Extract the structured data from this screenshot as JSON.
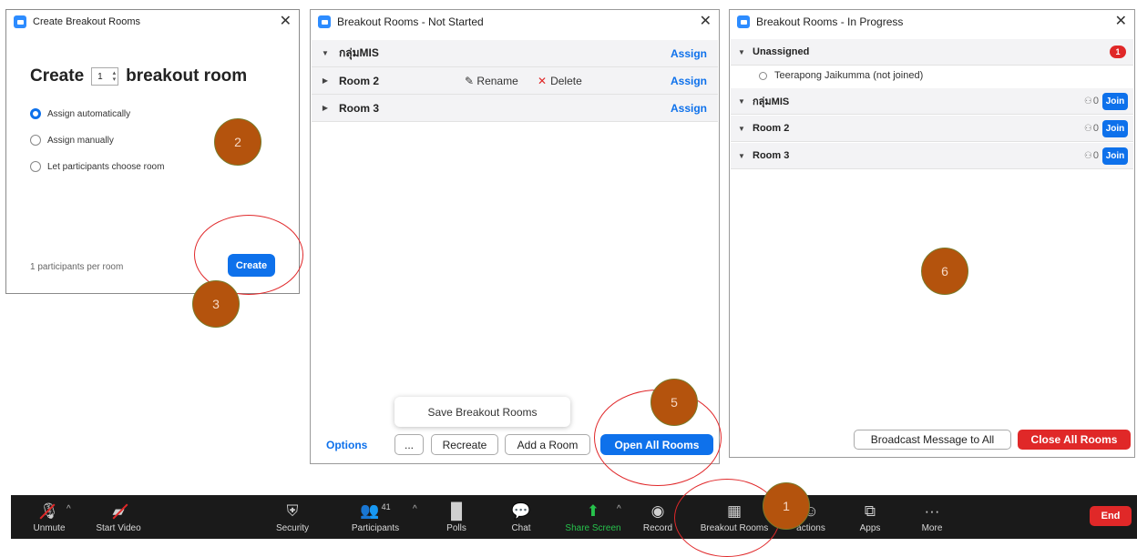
{
  "window_create": {
    "title": "Create Breakout Rooms",
    "create_label": "Create",
    "room_count": "1",
    "room_suffix": "breakout room",
    "options": [
      "Assign automatically",
      "Assign manually",
      "Let participants choose room"
    ],
    "selected_option": "Assign automatically",
    "per_room_text": "1 participants per room",
    "create_button": "Create"
  },
  "window_not_started": {
    "title": "Breakout Rooms - Not Started",
    "rooms": [
      {
        "name": "กลุ่มMIS",
        "assign": "Assign",
        "expanded": true
      },
      {
        "name": "Room 2",
        "assign": "Assign",
        "rename": "Rename",
        "delete": "Delete"
      },
      {
        "name": "Room 3",
        "assign": "Assign"
      }
    ],
    "save_popup": "Save Breakout Rooms",
    "options_label": "Options",
    "more_label": "...",
    "recreate": "Recreate",
    "add_room": "Add a Room",
    "open_all": "Open All Rooms"
  },
  "window_in_progress": {
    "title": "Breakout Rooms - In Progress",
    "unassigned": {
      "label": "Unassigned",
      "badge": "1"
    },
    "participant": "Teerapong Jaikumma (not joined)",
    "rooms": [
      {
        "name": "กลุ่มMIS",
        "count": "0",
        "join": "Join"
      },
      {
        "name": "Room 2",
        "count": "0",
        "join": "Join"
      },
      {
        "name": "Room 3",
        "count": "0",
        "join": "Join"
      }
    ],
    "broadcast": "Broadcast Message to All",
    "close_all": "Close All Rooms"
  },
  "toolbar": {
    "unmute": "Unmute",
    "start_video": "Start Video",
    "security": "Security",
    "participants": "Participants",
    "participants_count": "41",
    "polls": "Polls",
    "chat": "Chat",
    "share_screen": "Share Screen",
    "record": "Record",
    "breakout_rooms": "Breakout Rooms",
    "reactions": "actions",
    "apps": "Apps",
    "more": "More",
    "end": "End"
  },
  "annotations": {
    "step1": "1",
    "step2": "2",
    "step3": "3",
    "step5": "5",
    "step6": "6"
  },
  "colors": {
    "accent_blue": "#0e71eb",
    "danger_red": "#e02828",
    "step_circle": "#b4530d",
    "share_green": "#27c24c"
  }
}
